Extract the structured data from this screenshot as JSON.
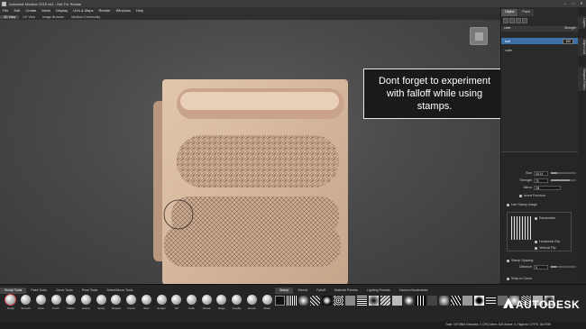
{
  "window": {
    "title": "Autodesk Mudbox 2015 x64 - Not For Resale"
  },
  "menu": [
    "File",
    "Edit",
    "Create",
    "Mesh",
    "Display",
    "UVs & Maps",
    "Render",
    "Windows",
    "Help"
  ],
  "view_tabs": [
    "3D View",
    "UV View",
    "Image Browser",
    "Mudbox Community"
  ],
  "callout": {
    "text": "Dont forget to experiment with falloff while using stamps."
  },
  "right_panel": {
    "tabs": [
      "Object",
      "Paint"
    ],
    "layers_header": {
      "name": "cube",
      "strength": "Strength"
    },
    "layers": [
      {
        "name": "bad",
        "value": "100",
        "selected": true
      },
      {
        "name": "cube",
        "value": "",
        "selected": false
      }
    ],
    "properties": {
      "size": {
        "label": "Size",
        "value": "15.14",
        "fill": 0.25
      },
      "strength": {
        "label": "Strength",
        "value": "75",
        "fill": 0.75
      },
      "mirror": {
        "label": "Mirror",
        "value": "Off"
      },
      "invert_function": "Invert Function",
      "use_stamp_image": "Use Stamp Image",
      "randomize": "Randomize",
      "horizontal_flip": "Horizontal Flip",
      "vertical_flip": "Vertical Flip",
      "stamp_spacing": "Stamp Spacing",
      "distance": {
        "label": "Distance",
        "value": "5"
      },
      "snap_to_curve": "Snap to Curve"
    }
  },
  "vertical_tabs": [
    "Layers",
    "Object List",
    "Viewport Filters"
  ],
  "tool_tabs": [
    "Sculpt Tools",
    "Paint Tools",
    "Curve Tools",
    "Pose Tools",
    "Select/Move Tools"
  ],
  "tools": [
    "Sculpt",
    "Smooth",
    "Grab",
    "Pinch",
    "Flatten",
    "Foamy",
    "Spray",
    "Repeat",
    "Imprint",
    "Wax",
    "Scrape",
    "Fill",
    "Knife",
    "Smear",
    "Bulge",
    "Amplify",
    "Freeze",
    "Mask"
  ],
  "stamp_tabs": [
    "Stamp",
    "Stencil",
    "Falloff",
    "Material Presets",
    "Lighting Presets",
    "Camera Bookmarks"
  ],
  "status": {
    "text": "Total: 1572864  Selected: 0  GPU Mem: 826  Active: 0, Highest: 0  FPS: 36.5789"
  },
  "brand": {
    "name": "AUTODESK"
  },
  "colors": {
    "accent": "#3d6fa8",
    "clay": "#d4b49a",
    "background": "#4a4a4a"
  }
}
